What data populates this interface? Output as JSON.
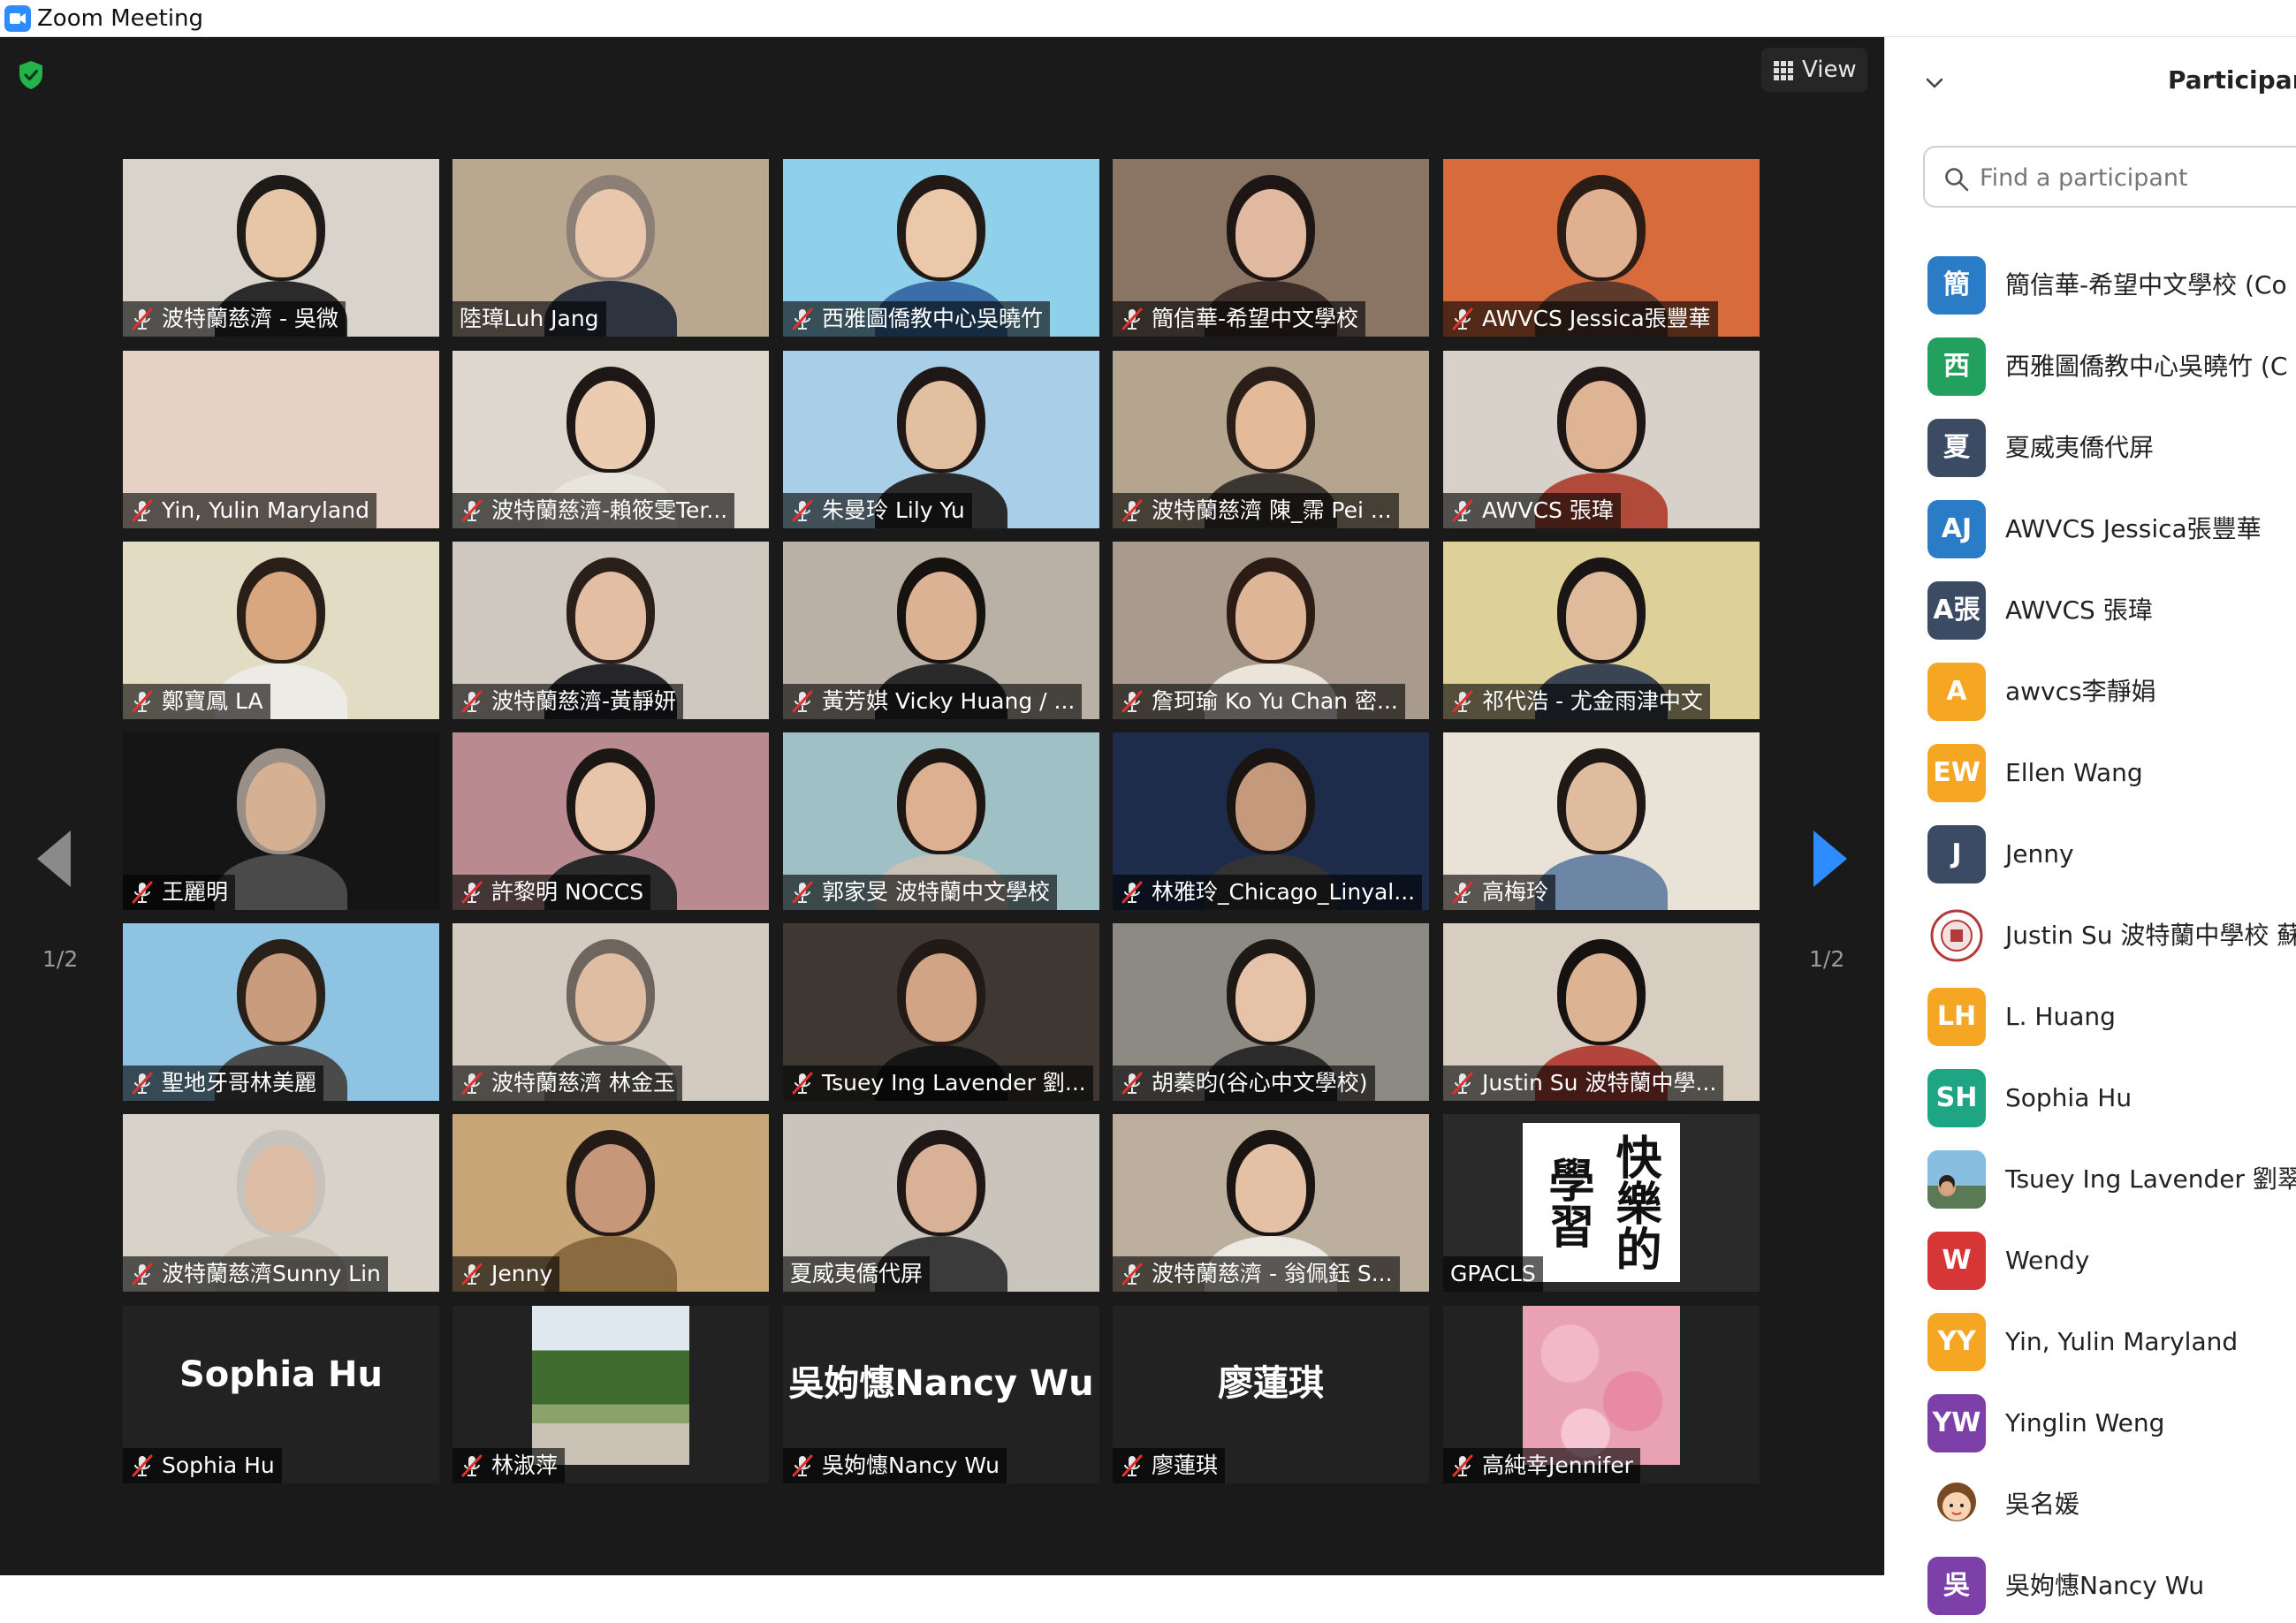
{
  "window": {
    "title": "Zoom Meeting"
  },
  "toolbar": {
    "view_label": "View"
  },
  "pagination": {
    "left": "1/2",
    "right": "1/2"
  },
  "tiles": [
    {
      "name": "波特蘭慈濟 - 吳微",
      "muted": true,
      "bg": "#d8d4cc",
      "skin": "#e7c6a8",
      "hair": "#1e1a18",
      "shirt": "#2b2b2b"
    },
    {
      "name": "陸璋Luh Jang",
      "muted": false,
      "bg": "#b9a790",
      "skin": "#e8c7ad",
      "hair": "#8c8076",
      "shirt": "#2d3440",
      "active": true
    },
    {
      "name": "西雅圖僑教中心吳曉竹",
      "muted": true,
      "bg": "#8fd0ea",
      "skin": "#ecc8aa",
      "hair": "#221a16",
      "shirt": "#3a6ea8"
    },
    {
      "name": "簡信華-希望中文學校",
      "muted": true,
      "bg": "#8a7565",
      "skin": "#e1b8a0",
      "hair": "#1d1614",
      "shirt": "#3d2e2a"
    },
    {
      "name": "AWVCS Jessica張豐華",
      "muted": true,
      "bg": "#d86b3c",
      "skin": "#e0b090",
      "hair": "#2b1d16",
      "shirt": "#5e3a2c"
    },
    {
      "name": "Yin, Yulin  Maryland",
      "muted": true,
      "bg": "#e6d2c4",
      "skin": "#e6d2c4",
      "hair": "#e6d2c4",
      "shirt": "#e6d2c4",
      "empty": true
    },
    {
      "name": "波特蘭慈濟-賴筱雯Ter...",
      "muted": true,
      "bg": "#ddd7cd",
      "skin": "#ecccb1",
      "hair": "#1d1816",
      "shirt": "#e9e4dc"
    },
    {
      "name": "朱曼玲 Lily Yu",
      "muted": true,
      "bg": "#a9cfe8",
      "skin": "#e3bfa1",
      "hair": "#1f1816",
      "shirt": "#2a2a2a"
    },
    {
      "name": "波特蘭慈濟 陳_霈 Pei ...",
      "muted": true,
      "bg": "#b6a58e",
      "skin": "#e3bb9b",
      "hair": "#2a1f18",
      "shirt": "#3b3630"
    },
    {
      "name": "AWVCS 張瑋",
      "muted": true,
      "bg": "#d8d1ca",
      "skin": "#dfb494",
      "hair": "#1e1715",
      "shirt": "#b24a3a"
    },
    {
      "name": "鄭寶鳳 LA",
      "muted": true,
      "bg": "#e2dcc4",
      "skin": "#d9a77f",
      "hair": "#2a1e18",
      "shirt": "#ecebe6"
    },
    {
      "name": "波特蘭慈濟-黃靜妍",
      "muted": true,
      "bg": "#cfc8bf",
      "skin": "#e4bea2",
      "hair": "#2a1f19",
      "shirt": "#25252a"
    },
    {
      "name": "黃芳娸 Vicky Huang / ...",
      "muted": true,
      "bg": "#b9b1a6",
      "skin": "#dbb294",
      "hair": "#16120f",
      "shirt": "#2a2a2a"
    },
    {
      "name": "詹珂瑜 Ko Yu Chan 密...",
      "muted": true,
      "bg": "#a89a8c",
      "skin": "#deb596",
      "hair": "#2b1d15",
      "shirt": "#ebe4db"
    },
    {
      "name": "祁代浩 - 尤金雨津中文",
      "muted": true,
      "bg": "#ddd098",
      "skin": "#e0bb9b",
      "hair": "#1a1616",
      "shirt": "#3b4452"
    },
    {
      "name": "王麗明",
      "muted": true,
      "bg": "#151515",
      "skin": "#d6b093",
      "hair": "#9a8f87",
      "shirt": "#4a4a4a"
    },
    {
      "name": "許黎明 NOCCS",
      "muted": true,
      "bg": "#b98b90",
      "skin": "#e8c4a8",
      "hair": "#1c1615",
      "shirt": "#2a2a2a"
    },
    {
      "name": "郭家旻 波特蘭中文學校",
      "muted": true,
      "bg": "#9fc0c4",
      "skin": "#dcb090",
      "hair": "#1d1612",
      "shirt": "#c9c1b6"
    },
    {
      "name": "林雅玲_Chicago_Linyal...",
      "muted": true,
      "bg": "#1c2c4a",
      "skin": "#c59a7c",
      "hair": "#1a1412",
      "shirt": "#333333"
    },
    {
      "name": "高梅玲",
      "muted": true,
      "bg": "#e9e2d6",
      "skin": "#e0bc9f",
      "hair": "#1e1816",
      "shirt": "#6d86a6"
    },
    {
      "name": "聖地牙哥林美麗",
      "muted": true,
      "bg": "#8fc3e2",
      "skin": "#c99c7d",
      "hair": "#2a201a",
      "shirt": "#4b4b4b"
    },
    {
      "name": "波特蘭慈濟 林金玉",
      "muted": true,
      "bg": "#d3cbbf",
      "skin": "#dfbda2",
      "hair": "#6e665e",
      "shirt": "#8a8680"
    },
    {
      "name": "Tsuey Ing Lavender 劉...",
      "muted": true,
      "bg": "#3e3732",
      "skin": "#d0a484",
      "hair": "#221a16",
      "shirt": "#161616"
    },
    {
      "name": "胡蓁昀(谷心中文學校)",
      "muted": true,
      "bg": "#8d8a83",
      "skin": "#e6c3a8",
      "hair": "#1f1916",
      "shirt": "#2b2b2b"
    },
    {
      "name": "Justin Su 波特蘭中學...",
      "muted": true,
      "bg": "#d7cdc0",
      "skin": "#dcb393",
      "hair": "#161211",
      "shirt": "#b2453c"
    },
    {
      "name": "波特蘭慈濟Sunny Lin",
      "muted": true,
      "bg": "#d8d2c9",
      "skin": "#ddbda5",
      "hair": "#c6c2bc",
      "shirt": "#c9c3b8"
    },
    {
      "name": "Jenny",
      "muted": true,
      "bg": "#c8a678",
      "skin": "#c8977a",
      "hair": "#241b16",
      "shirt": "#8a6a40"
    },
    {
      "name": "夏威夷僑代屏",
      "muted": false,
      "bg": "#c9c4bc",
      "skin": "#d9b196",
      "hair": "#1f1816",
      "shirt": "#3b3b3b"
    },
    {
      "name": "波特蘭慈濟 - 翁佩鈺 S...",
      "muted": true,
      "bg": "#bcaf9e",
      "skin": "#e4c1a4",
      "hair": "#1a1513",
      "shirt": "#ece8e2"
    },
    {
      "name": "GPACLS",
      "muted": false,
      "bg": "#2a2a2a",
      "skin": "#ffffff",
      "hair": "#ffffff",
      "shirt": "#ffffff",
      "calligraphy": "快樂的學習"
    },
    {
      "name": "Sophia Hu",
      "muted": true,
      "bg": "#222222",
      "big": "Sophia Hu"
    },
    {
      "name": "林淑萍",
      "muted": true,
      "bg": "#222222",
      "landscape": true
    },
    {
      "name": "吳姁憓Nancy Wu",
      "muted": true,
      "bg": "#222222",
      "big": "吳姁憓Nancy  Wu"
    },
    {
      "name": "廖蓮琪",
      "muted": true,
      "bg": "#222222",
      "big": "廖蓮琪"
    },
    {
      "name": "高純幸Jennifer",
      "muted": true,
      "bg": "#222222",
      "blossom": true
    }
  ],
  "sidebar": {
    "title": "Participants",
    "search_placeholder": "Find a participant",
    "participants": [
      {
        "initials": "簡",
        "name": "簡信華-希望中文學校 (Co",
        "color": "#2a7cc7"
      },
      {
        "initials": "西",
        "name": "西雅圖僑教中心吳曉竹 (C",
        "color": "#23a05e"
      },
      {
        "initials": "夏",
        "name": "夏威夷僑代屏",
        "color": "#3b4b63"
      },
      {
        "initials": "AJ",
        "name": "AWVCS Jessica張豐華",
        "color": "#2a7cc7"
      },
      {
        "initials": "A張",
        "name": "AWVCS 張瑋",
        "color": "#3b4b63"
      },
      {
        "initials": "A",
        "name": "awvcs李靜娟",
        "color": "#f5a623"
      },
      {
        "initials": "EW",
        "name": "Ellen Wang",
        "color": "#f5a623"
      },
      {
        "initials": "J",
        "name": "Jenny",
        "color": "#3b4b63"
      },
      {
        "initials": "",
        "name": "Justin Su 波特蘭中學校 蘇",
        "color": "#ffffff",
        "logo": true
      },
      {
        "initials": "LH",
        "name": "L. Huang",
        "color": "#f5a623"
      },
      {
        "initials": "SH",
        "name": "Sophia Hu",
        "color": "#1ea584"
      },
      {
        "initials": "",
        "name": "Tsuey Ing Lavender 劉翠英",
        "color": "#7fb4d8",
        "photo": true
      },
      {
        "initials": "W",
        "name": "Wendy",
        "color": "#d63636"
      },
      {
        "initials": "YY",
        "name": "Yin, Yulin  Maryland",
        "color": "#f5a623"
      },
      {
        "initials": "YW",
        "name": "Yinglin Weng",
        "color": "#7d3fa8"
      },
      {
        "initials": "",
        "name": "吳名媛",
        "color": "#ffffff",
        "cartoon": true
      },
      {
        "initials": "吳",
        "name": "吳姁憓Nancy Wu",
        "color": "#7d3fa8"
      }
    ]
  }
}
